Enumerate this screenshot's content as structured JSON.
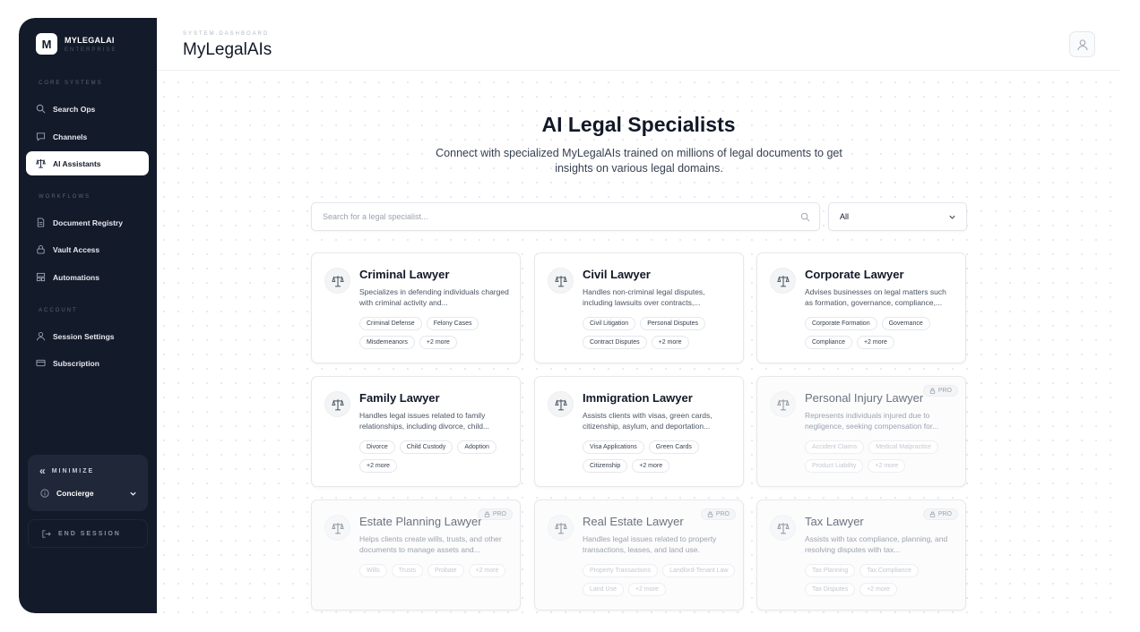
{
  "sidebar": {
    "brand": {
      "logo_letter": "M",
      "name": "MYLEGALAI",
      "subtitle": "ENTERPRISE"
    },
    "sections": [
      {
        "label": "CORE SYSTEMS",
        "items": [
          {
            "label": "Search Ops",
            "icon": "search-icon"
          },
          {
            "label": "Channels",
            "icon": "message-icon"
          },
          {
            "label": "AI Assistants",
            "icon": "scales-icon",
            "active": true
          }
        ]
      },
      {
        "label": "WORKFLOWS",
        "items": [
          {
            "label": "Document Registry",
            "icon": "document-icon"
          },
          {
            "label": "Vault Access",
            "icon": "lock-icon"
          },
          {
            "label": "Automations",
            "icon": "automation-icon"
          }
        ]
      },
      {
        "label": "ACCOUNT",
        "items": [
          {
            "label": "Session Settings",
            "icon": "user-icon"
          },
          {
            "label": "Subscription",
            "icon": "card-icon"
          }
        ]
      }
    ],
    "minimize_label": "MINIMIZE",
    "concierge_label": "Concierge",
    "end_session_label": "END SESSION"
  },
  "header": {
    "breadcrumb": "SYSTEM.DASHBOARD",
    "title": "MyLegalAIs"
  },
  "hero": {
    "title": "AI Legal Specialists",
    "subtitle": "Connect with specialized MyLegalAIs trained on millions of legal documents to get insights on various legal domains."
  },
  "search": {
    "placeholder": "Search for a legal specialist...",
    "value": ""
  },
  "filter": {
    "selected": "All"
  },
  "cards": [
    {
      "title": "Criminal Lawyer",
      "description": "Specializes in defending individuals charged with criminal activity and...",
      "tags": [
        "Criminal Defense",
        "Felony Cases",
        "Misdemeanors",
        "+2 more"
      ],
      "pro": false
    },
    {
      "title": "Civil Lawyer",
      "description": "Handles non-criminal legal disputes, including lawsuits over contracts,...",
      "tags": [
        "Civil Litigation",
        "Personal Disputes",
        "Contract Disputes",
        "+2 more"
      ],
      "pro": false
    },
    {
      "title": "Corporate Lawyer",
      "description": "Advises businesses on legal matters such as formation, governance, compliance,...",
      "tags": [
        "Corporate Formation",
        "Governance",
        "Compliance",
        "+2 more"
      ],
      "pro": false
    },
    {
      "title": "Family Lawyer",
      "description": "Handles legal issues related to family relationships, including divorce, child...",
      "tags": [
        "Divorce",
        "Child Custody",
        "Adoption",
        "+2 more"
      ],
      "pro": false
    },
    {
      "title": "Immigration Lawyer",
      "description": "Assists clients with visas, green cards, citizenship, asylum, and deportation...",
      "tags": [
        "Visa Applications",
        "Green Cards",
        "Citizenship",
        "+2 more"
      ],
      "pro": false
    },
    {
      "title": "Personal Injury Lawyer",
      "description": "Represents individuals injured due to negligence, seeking compensation for...",
      "tags": [
        "Accident Claims",
        "Medical Malpractice",
        "Product Liability",
        "+2 more"
      ],
      "pro": true
    },
    {
      "title": "Estate Planning Lawyer",
      "description": "Helps clients create wills, trusts, and other documents to manage assets and...",
      "tags": [
        "Wills",
        "Trusts",
        "Probate",
        "+2 more"
      ],
      "pro": true
    },
    {
      "title": "Real Estate Lawyer",
      "description": "Handles legal issues related to property transactions, leases, and land use.",
      "tags": [
        "Property Transactions",
        "Landlord-Tenant Law",
        "Land Use",
        "+2 more"
      ],
      "pro": true
    },
    {
      "title": "Tax Lawyer",
      "description": "Assists with tax compliance, planning, and resolving disputes with tax...",
      "tags": [
        "Tax Planning",
        "Tax Compliance",
        "Tax Disputes",
        "+2 more"
      ],
      "pro": true
    }
  ],
  "pro_badge_label": "PRO",
  "colors": {
    "sidebar_bg": "#131a2a",
    "accent": "#111827",
    "page_bg": "#ffffff"
  }
}
